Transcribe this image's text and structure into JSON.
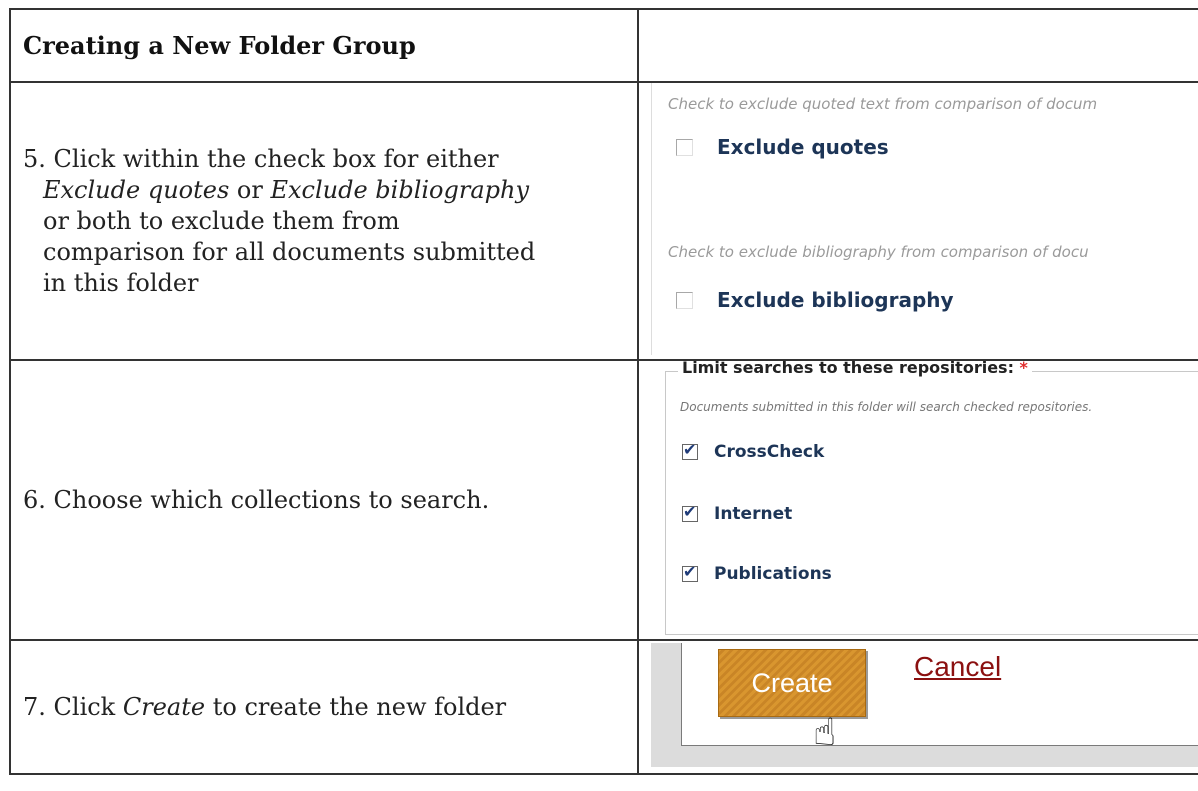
{
  "header": {
    "title": "Creating a New Folder Group"
  },
  "step5": {
    "text_prefix": "5. Click within the check box for either",
    "opt1": "Exclude quotes",
    "or_word": "or",
    "opt2": "Exclude bibliography",
    "text_rest_1": "or both to exclude them from",
    "text_rest_2": "comparison for all documents submitted",
    "text_rest_3": "in this folder",
    "shot": {
      "hint_quotes": "Check to exclude quoted text from comparison of docum",
      "label_quotes": "Exclude quotes",
      "hint_biblio": "Check to exclude bibliography from comparison of docu",
      "label_biblio": "Exclude bibliography"
    }
  },
  "step6": {
    "text": "6. Choose which collections to search.",
    "shot": {
      "legend": "Limit searches to these repositories:",
      "required_mark": "*",
      "description": "Documents submitted in this folder will search checked repositories.",
      "repositories": [
        "CrossCheck",
        "Internet",
        "Publications"
      ]
    }
  },
  "step7": {
    "text_prefix": "7. Click",
    "create_word": "Create",
    "text_suffix": "to create the new folder",
    "shot": {
      "create_label": "Create",
      "cancel_label": "Cancel"
    }
  },
  "icons": {
    "pointer": "hand-pointer-icon"
  }
}
